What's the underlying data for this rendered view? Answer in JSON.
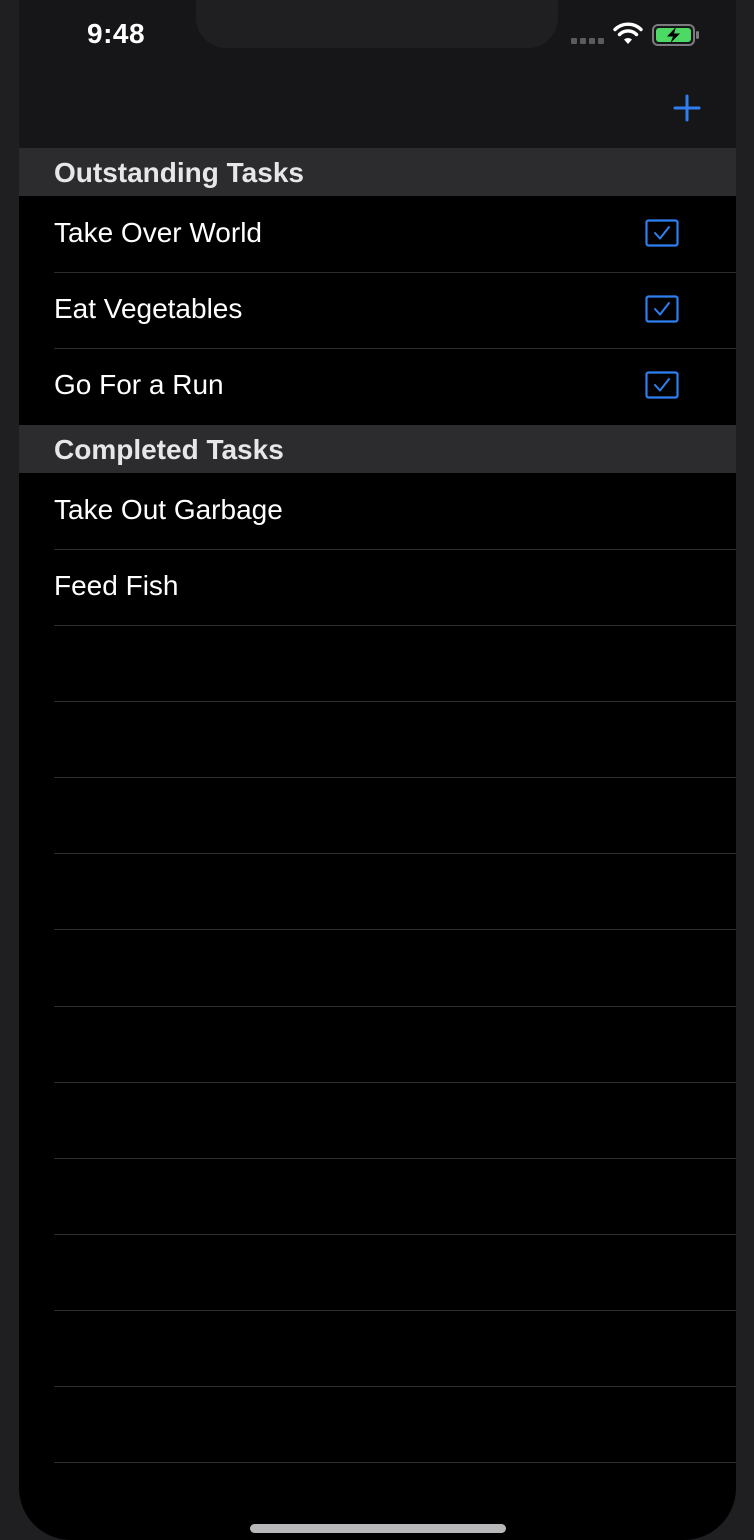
{
  "status_bar": {
    "time": "9:48",
    "icons": [
      "signal-dots-icon",
      "wifi-icon",
      "battery-charging-icon"
    ]
  },
  "nav": {
    "add_icon": "plus-icon"
  },
  "colors": {
    "accent": "#2f7ff0",
    "background": "#000000",
    "section_header": "#2c2c2e",
    "battery_fill": "#4cd964"
  },
  "sections": [
    {
      "title": "Outstanding Tasks",
      "items": [
        {
          "label": "Take Over World",
          "checked": true
        },
        {
          "label": "Eat Vegetables",
          "checked": true
        },
        {
          "label": "Go For a Run",
          "checked": true
        }
      ]
    },
    {
      "title": "Completed Tasks",
      "items": [
        {
          "label": "Take Out Garbage"
        },
        {
          "label": "Feed Fish"
        }
      ]
    }
  ]
}
